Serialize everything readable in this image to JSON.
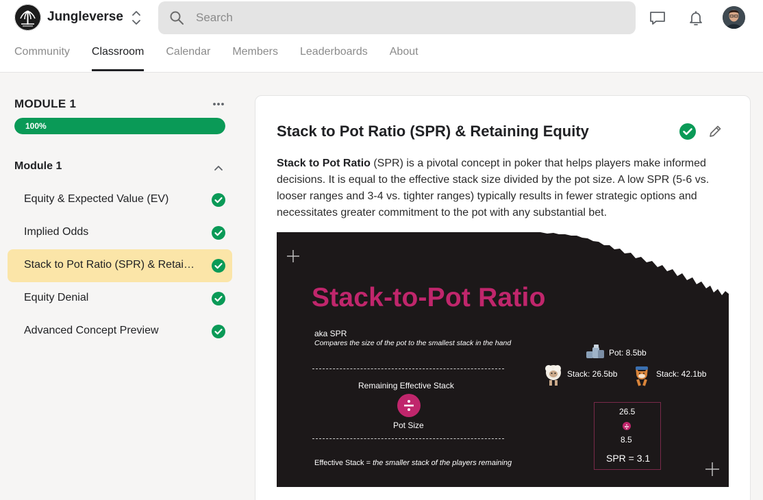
{
  "app": {
    "name": "Jungleverse"
  },
  "search": {
    "placeholder": "Search"
  },
  "tabs": [
    {
      "label": "Community"
    },
    {
      "label": "Classroom"
    },
    {
      "label": "Calendar"
    },
    {
      "label": "Members"
    },
    {
      "label": "Leaderboards"
    },
    {
      "label": "About"
    }
  ],
  "active_tab": "Classroom",
  "sidebar": {
    "module_title": "MODULE 1",
    "progress_value": 1.0,
    "progress_label": "100%",
    "section_title": "Module 1",
    "lessons": [
      {
        "label": "Equity & Expected Value (EV)",
        "completed": true
      },
      {
        "label": "Implied Odds",
        "completed": true
      },
      {
        "label": "Stack to Pot Ratio (SPR) & Retaining Equity",
        "completed": true,
        "active": true
      },
      {
        "label": "Equity Denial",
        "completed": true
      },
      {
        "label": "Advanced Concept Preview",
        "completed": true
      }
    ]
  },
  "lesson": {
    "title": "Stack to Pot Ratio (SPR) & Retaining Equity",
    "desc_bold": "Stack to Pot Ratio",
    "desc_rest": " (SPR) is a pivotal concept in poker that helps players make informed decisions. It is equal to the effective stack size divided by the pot size. A low SPR (5-6 vs. looser ranges and 3-4 vs. tighter ranges) typically results in fewer strategic options and necessitates greater commitment to the pot with any substantial bet."
  },
  "slide": {
    "title": "Stack-to-Pot Ratio",
    "aka": "aka SPR",
    "aka_sub": "Compares the size of the pot to the smallest stack in the hand",
    "numerator": "Remaining Effective Stack",
    "denominator": "Pot Size",
    "footer_prefix": "Effective Stack = ",
    "footer_italic": "the smaller stack of the players remaining",
    "pot": "Pot: 8.5bb",
    "stack_left": "Stack: 26.5bb",
    "stack_right": "Stack: 42.1bb",
    "calc_top": "26.5",
    "calc_bottom": "8.5",
    "calc_result": "SPR = 3.1"
  },
  "colors": {
    "accent_green": "#0a9a57",
    "active_lesson_bg": "#fbe5a8",
    "slide_magenta": "#c0266c",
    "slide_bg": "#1c1819"
  }
}
